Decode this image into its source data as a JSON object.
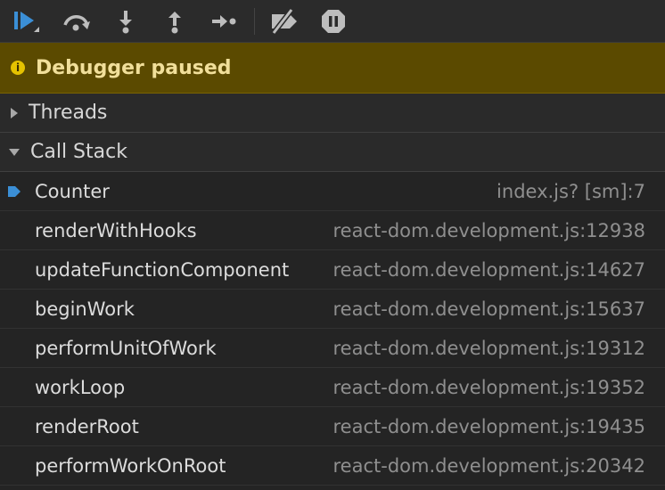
{
  "toolbar": {
    "buttons": [
      {
        "name": "resume-icon"
      },
      {
        "name": "step-over-icon"
      },
      {
        "name": "step-into-icon"
      },
      {
        "name": "step-out-icon"
      },
      {
        "name": "step-icon"
      },
      {
        "name": "deactivate-breakpoints-icon"
      },
      {
        "name": "pause-on-exceptions-icon"
      }
    ],
    "accent_color": "#3b8fd6"
  },
  "banner": {
    "text": "Debugger paused",
    "background": "#5b4a00",
    "icon": "info-icon"
  },
  "sections": {
    "threads": {
      "label": "Threads",
      "expanded": false
    },
    "call_stack": {
      "label": "Call Stack",
      "expanded": true
    }
  },
  "call_stack": [
    {
      "fn": "Counter",
      "loc": "index.js? [sm]:7",
      "current": true
    },
    {
      "fn": "renderWithHooks",
      "loc": "react-dom.development.js:12938"
    },
    {
      "fn": "updateFunctionComponent",
      "loc": "react-dom.development.js:14627"
    },
    {
      "fn": "beginWork",
      "loc": "react-dom.development.js:15637"
    },
    {
      "fn": "performUnitOfWork",
      "loc": "react-dom.development.js:19312"
    },
    {
      "fn": "workLoop",
      "loc": "react-dom.development.js:19352"
    },
    {
      "fn": "renderRoot",
      "loc": "react-dom.development.js:19435"
    },
    {
      "fn": "performWorkOnRoot",
      "loc": "react-dom.development.js:20342"
    }
  ]
}
